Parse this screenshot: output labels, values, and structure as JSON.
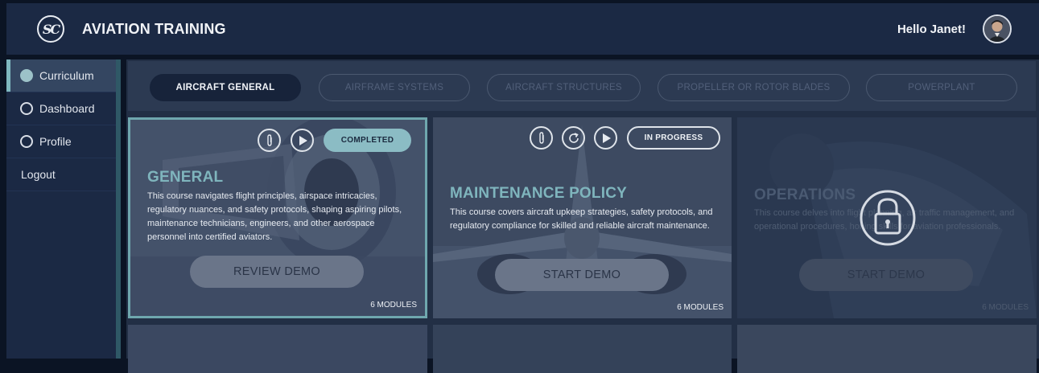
{
  "header": {
    "logo_text": "SC",
    "title": "AVIATION TRAINING",
    "greeting": "Hello Janet!",
    "avatar_icon": "user-avatar"
  },
  "sidebar": {
    "items": [
      {
        "label": "Curriculum",
        "icon": "circle-icon",
        "active": true
      },
      {
        "label": "Dashboard",
        "icon": "circle-icon",
        "active": false
      },
      {
        "label": "Profile",
        "icon": "circle-icon",
        "active": false
      },
      {
        "label": "Logout",
        "active": false
      }
    ]
  },
  "tabs": [
    {
      "label": "AIRCRAFT GENERAL",
      "active": true
    },
    {
      "label": "AIRFRAME SYSTEMS",
      "active": false
    },
    {
      "label": "AIRCRAFT STRUCTURES",
      "active": false
    },
    {
      "label": "PROPELLER OR ROTOR BLADES",
      "active": false
    },
    {
      "label": "POWERPLANT",
      "active": false
    }
  ],
  "cards": [
    {
      "title": "GENERAL",
      "description": "This course navigates flight principles, airspace intricacies, regulatory nuances, and safety protocols, shaping aspiring pilots, maintenance technicians, engineers, and other aerospace personnel into certified aviators.",
      "button": "REVIEW DEMO",
      "modules": "6 MODULES",
      "status": "COMPLETED",
      "icons": [
        "paperclip-icon",
        "play-icon"
      ]
    },
    {
      "title": "MAINTENANCE POLICY",
      "description": "This course covers aircraft upkeep strategies, safety protocols, and regulatory compliance for skilled and reliable aircraft maintenance.",
      "button": "START DEMO",
      "modules": "6 MODULES",
      "status": "IN PROGRESS",
      "icons": [
        "paperclip-icon",
        "refresh-icon",
        "play-icon"
      ]
    },
    {
      "title": "OPERATIONS",
      "description": "This course delves into flight planning, air traffic management, and operational procedures, honing skills for aviation professionals.",
      "button": "START DEMO",
      "modules": "6 MODULES",
      "status": "locked",
      "icons": [
        "lock-icon"
      ]
    }
  ],
  "colors": {
    "header_bg": "#1b2944",
    "accent": "#7fb8c0",
    "completed_badge": "#8bbcc4",
    "page_bg": "#0b1424"
  }
}
